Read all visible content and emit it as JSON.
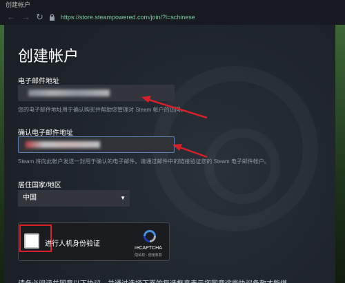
{
  "window": {
    "title": "创建帐户"
  },
  "navbar": {
    "url": "https://store.steampowered.com/join/?l=schinese"
  },
  "form": {
    "heading": "创建帐户",
    "email_label": "电子邮件地址",
    "email_hint": "您的电子邮件地址用于确认购买并帮助您管理对 Steam 帐户的访问。",
    "confirm_label": "确认电子邮件地址",
    "confirm_hint": "Steam 将向此帐户发送一封用于确认的电子邮件。请通过邮件中的链接验证您的 Steam 电子邮件帐户。",
    "country_label": "居住国家/地区",
    "country_selected": "中国",
    "captcha_label": "进行人机身份验证",
    "captcha_brand": "reCAPTCHA",
    "captcha_terms": "隐私权 - 使用条款",
    "footer_text": "请务必阅读并同意以下协议，并通过选择下面的复选框来表示您同意这些协议条款才能继"
  },
  "colors": {
    "accent": "#d8202a",
    "background": "#1b1f24"
  }
}
